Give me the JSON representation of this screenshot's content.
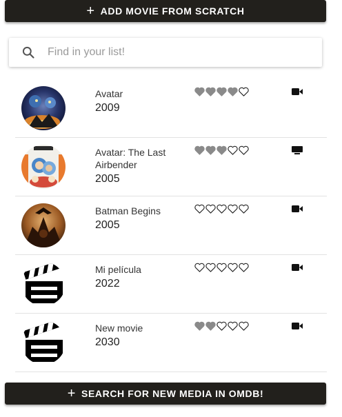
{
  "top_button": {
    "label": "ADD MOVIE FROM SCRATCH"
  },
  "search": {
    "placeholder": "Find in your list!",
    "value": ""
  },
  "items": [
    {
      "title": "Avatar",
      "year": "2009",
      "rating": 4,
      "type": "movie",
      "poster": "avatar-poster"
    },
    {
      "title": "Avatar: The Last Airbender",
      "year": "2005",
      "rating": 3,
      "type": "series",
      "poster": "airbender-poster"
    },
    {
      "title": "Batman Begins",
      "year": "2005",
      "rating": 0,
      "type": "movie",
      "poster": "batman-poster"
    },
    {
      "title": "Mi película",
      "year": "2022",
      "rating": 0,
      "type": "movie",
      "poster": "clapperboard-icon"
    },
    {
      "title": "New movie",
      "year": "2030",
      "rating": 2,
      "type": "movie",
      "poster": "clapperboard-icon"
    }
  ],
  "max_rating": 5,
  "bottom_button": {
    "label": "SEARCH FOR NEW MEDIA IN OMDB!"
  },
  "colors": {
    "button_bg": "#22201c",
    "heart_filled": "#8a8a8a",
    "heart_outline": "#222222"
  }
}
